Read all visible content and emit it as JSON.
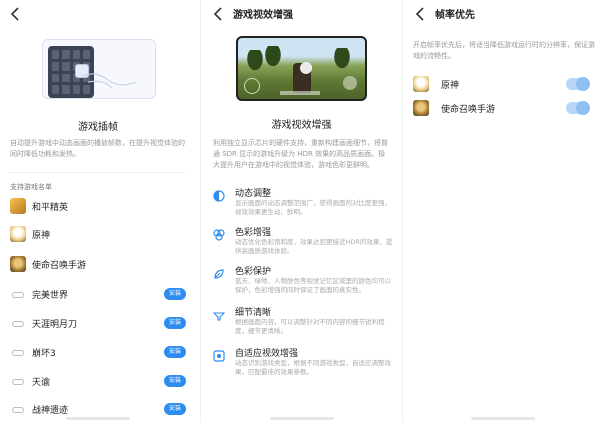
{
  "colors": {
    "accent": "#2c8cf0",
    "muted_text": "#999999",
    "toggle_on": "#b8d7f7"
  },
  "panel1": {
    "feature_title": "游戏插帧",
    "feature_desc": "自动提升游戏中动态画面的播放帧数，在提升视觉体验的同时降低功耗和发热。",
    "section_label": "支持游戏名单",
    "supported_games": [
      {
        "name": "和平精英",
        "icon": "peace-elite-icon"
      },
      {
        "name": "原神",
        "icon": "genshin-icon"
      },
      {
        "name": "使命召唤手游",
        "icon": "cod-mobile-icon"
      }
    ],
    "installable_games": [
      {
        "name": "完美世界",
        "button": "安装"
      },
      {
        "name": "天涯明月刀",
        "button": "安装"
      },
      {
        "name": "崩坏3",
        "button": "安装"
      },
      {
        "name": "天谕",
        "button": "安装"
      },
      {
        "name": "战神遗迹",
        "button": "安装"
      }
    ]
  },
  "panel2": {
    "title": "游戏视效增强",
    "feature_title": "游戏视效增强",
    "feature_desc": "利用独立显示芯片的硬件支持，重新构建画面细节，将普通 SDR 显示的游戏升级为 HDR 效果的高品质画面。极大提升用户在游戏中的视觉体验，游戏色彩更鲜明。",
    "features": [
      {
        "name": "动态调整",
        "desc": "显示画面的动态调整范围广，使得画面的对比度更强，视效效果更生动、鲜明。",
        "icon": "dynamic-adjust-icon"
      },
      {
        "name": "色彩增强",
        "desc": "动态优化色彩饱和度，效果达到更接近HDR的效果，提供高画质游戏体验。",
        "icon": "color-enhance-icon"
      },
      {
        "name": "色彩保护",
        "desc": "蓝天、绿地、人物肤色等视觉记忆区域里的颜色均可以保护，色彩增强的同时保证了画面的真实性。",
        "icon": "color-protect-icon"
      },
      {
        "name": "细节清晰",
        "desc": "根据画面内容，可以调整针对不同内容的细节锐利程度，细节更清晰。",
        "icon": "detail-clear-icon"
      },
      {
        "name": "自适应视效增强",
        "desc": "动态识别游戏类型，根据不同游戏类型，自适应调整效果，匹配最佳的效果参数。",
        "icon": "adaptive-enhance-icon"
      }
    ]
  },
  "panel3": {
    "title": "帧率优先",
    "desc": "开启帧率优先后，将适当降低游戏运行时的分辨率，保证游戏的流畅性。",
    "games": [
      {
        "name": "原神",
        "icon": "genshin-icon",
        "enabled": true
      },
      {
        "name": "使命召唤手游",
        "icon": "cod-mobile-icon",
        "enabled": true
      }
    ]
  }
}
